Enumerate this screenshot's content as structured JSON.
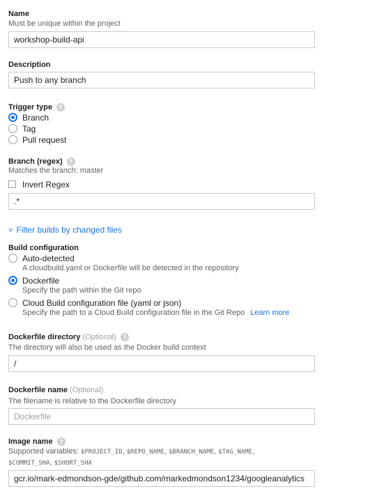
{
  "name": {
    "label": "Name",
    "hint": "Must be unique within the project",
    "value": "workshop-build-api"
  },
  "description": {
    "label": "Description",
    "value": "Push to any branch"
  },
  "trigger_type": {
    "label": "Trigger type",
    "help_glyph": "?",
    "options": [
      "Branch",
      "Tag",
      "Pull request"
    ],
    "selected": "Branch"
  },
  "branch": {
    "label": "Branch (regex)",
    "help_glyph": "?",
    "hint": "Matches the branch: master",
    "invert_label": "Invert Regex",
    "value": ".*"
  },
  "filter_link": {
    "chevron": "˅",
    "label": "Filter builds by changed files"
  },
  "build_config": {
    "label": "Build configuration",
    "options": [
      {
        "label": "Auto-detected",
        "hint": "A cloudbuild.yaml or Dockerfile will be detected in the repository"
      },
      {
        "label": "Dockerfile",
        "hint": "Specify the path within the Git repo"
      },
      {
        "label": "Cloud Build configuration file (yaml or json)",
        "hint": "Specify the path to a Cloud Build configuration file in the Git Repo"
      }
    ],
    "selected": "Dockerfile",
    "learn_more": "Learn more"
  },
  "dockerfile_directory": {
    "label": "Dockerfile directory",
    "optional": "(Optional)",
    "help_glyph": "?",
    "hint": "The directory will also be used as the Docker build context",
    "value": "/"
  },
  "dockerfile_name": {
    "label": "Dockerfile name",
    "optional": "(Optional)",
    "hint": "The filename is relative to the Dockerfile directory",
    "placeholder": "Dockerfile"
  },
  "image_name": {
    "label": "Image name",
    "help_glyph": "?",
    "hint_prefix": "Supported variables:",
    "variables_line1": [
      "$PROJECT_ID",
      "$REPO_NAME",
      "$BRANCH_NAME",
      "$TAG_NAME"
    ],
    "variables_line2": [
      "$COMMIT_SHA",
      "$SHORT_SHA"
    ],
    "value": "gcr.io/mark-edmondson-gde/github.com/markedmondson1234/googleanalytics"
  }
}
